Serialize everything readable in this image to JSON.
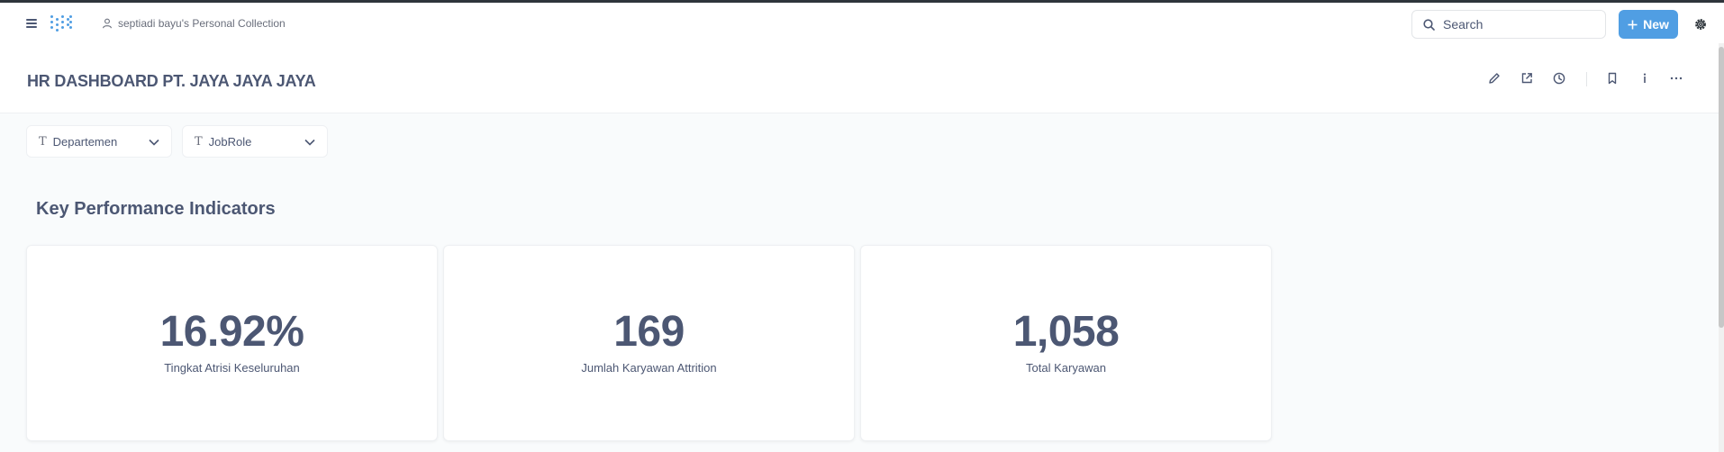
{
  "nav": {
    "collection": "septiadi bayu's Personal Collection",
    "search_placeholder": "Search",
    "new_label": "New"
  },
  "dashboard": {
    "title": "HR DASHBOARD PT. JAYA JAYA JAYA"
  },
  "filters": [
    {
      "label": "Departemen",
      "icon": "text-filter-icon"
    },
    {
      "label": "JobRole",
      "icon": "text-filter-icon"
    }
  ],
  "section": {
    "title": "Key Performance Indicators"
  },
  "cards": [
    {
      "value": "16.92%",
      "label": "Tingkat Atrisi Keseluruhan"
    },
    {
      "value": "169",
      "label": "Jumlah Karyawan Attrition"
    },
    {
      "value": "1,058",
      "label": "Total Karyawan"
    }
  ],
  "colors": {
    "brand": "#509ee3",
    "text": "#4c5773",
    "background": "#f9fbfc"
  }
}
